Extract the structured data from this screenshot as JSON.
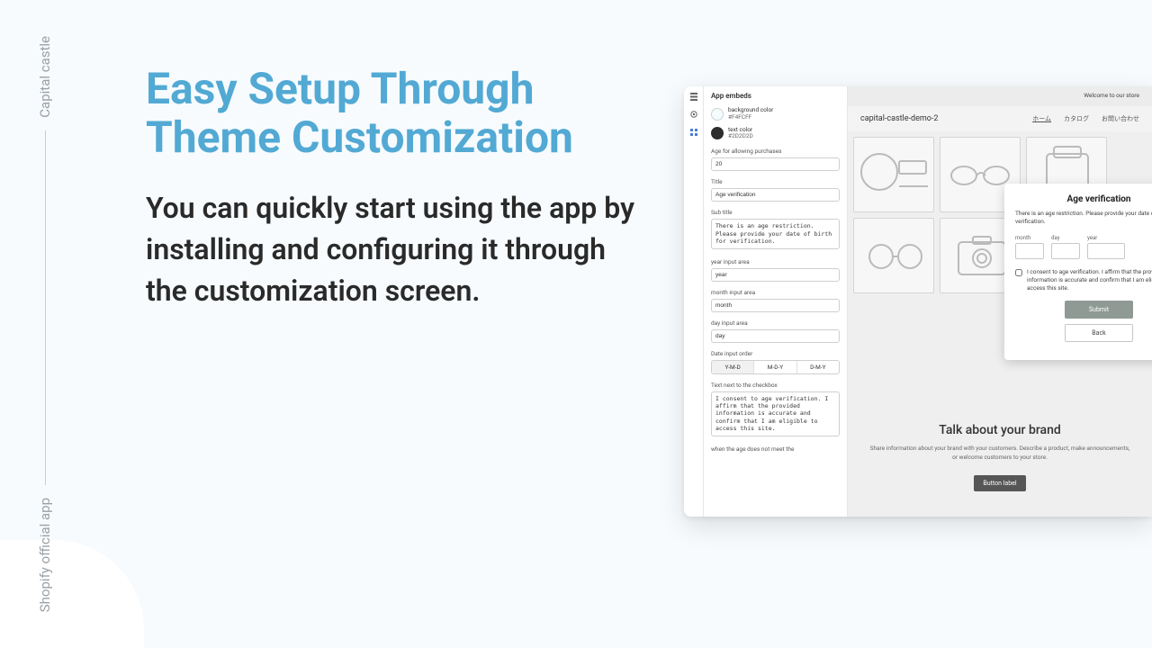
{
  "rail": {
    "top": "Capital castle",
    "bottom": "Shopify official app"
  },
  "promo": {
    "heading": "Easy Setup Through Theme Customization",
    "body": "You can quickly start using the app by installing and configuring it through the customization screen."
  },
  "panel": {
    "title": "App embeds",
    "bgcolor": {
      "label": "background color",
      "hex": "#F4FCFF"
    },
    "textcolor": {
      "label": "text color",
      "hex": "#2D2D2D"
    },
    "age_label": "Age for allowing purchases",
    "age_value": "20",
    "title_label": "Title",
    "title_value": "Age verification",
    "subtitle_label": "Sub title",
    "subtitle_value": "There is an age restriction. Please provide your date of birth for verification.",
    "year_label": "year input area",
    "year_value": "year",
    "month_label": "month input area",
    "month_value": "month",
    "day_label": "day input area",
    "day_value": "day",
    "order_label": "Date input order",
    "order_opts": {
      "a": "Y-M-D",
      "b": "M-D-Y",
      "c": "D-M-Y"
    },
    "checkbox_label": "Text next to the checkbox",
    "checkbox_value": "I consent to age verification. I affirm that the provided information is accurate and confirm that I am eligible to access this site.",
    "truncated": "when the age does not meet the"
  },
  "preview": {
    "announcement": "Welcome to our store",
    "brand": "capital-castle-demo-2",
    "nav": {
      "home": "ホーム",
      "catalog": "カタログ",
      "contact": "お問い合わせ"
    },
    "modal": {
      "title": "Age verification",
      "subtitle": "There is an age restriction. Please provide your date of birth for verification.",
      "month": "month",
      "day": "day",
      "year": "year",
      "consent": "I consent to age verification. I affirm that the provided information is accurate and confirm that I am eligible to access this site.",
      "submit": "Submit",
      "back": "Back"
    },
    "footer": {
      "heading": "Talk about your brand",
      "body": "Share information about your brand with your customers. Describe a product, make announcements, or welcome customers to your store.",
      "cta": "Button label"
    }
  }
}
